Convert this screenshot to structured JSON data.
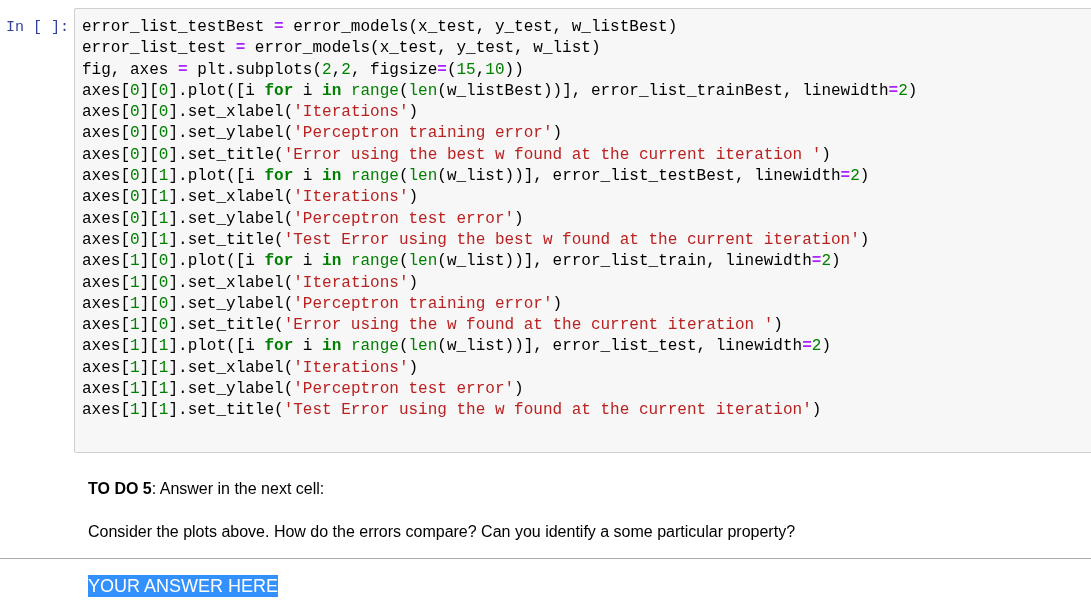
{
  "code_cell": {
    "prompt": "In [ ]:",
    "lines": [
      [
        {
          "kind": "plain",
          "text": "error_list_testBest "
        },
        {
          "kind": "op",
          "text": "="
        },
        {
          "kind": "plain",
          "text": " error_models(x_test, y_test, w_listBest)"
        }
      ],
      [
        {
          "kind": "plain",
          "text": "error_list_test "
        },
        {
          "kind": "op",
          "text": "="
        },
        {
          "kind": "plain",
          "text": " error_models(x_test, y_test, w_list)"
        }
      ],
      [
        {
          "kind": "plain",
          "text": "fig, axes "
        },
        {
          "kind": "op",
          "text": "="
        },
        {
          "kind": "plain",
          "text": " plt.subplots("
        },
        {
          "kind": "num",
          "text": "2"
        },
        {
          "kind": "plain",
          "text": ","
        },
        {
          "kind": "num",
          "text": "2"
        },
        {
          "kind": "plain",
          "text": ", figsize"
        },
        {
          "kind": "op",
          "text": "="
        },
        {
          "kind": "plain",
          "text": "("
        },
        {
          "kind": "num",
          "text": "15"
        },
        {
          "kind": "plain",
          "text": ","
        },
        {
          "kind": "num",
          "text": "10"
        },
        {
          "kind": "plain",
          "text": "))"
        }
      ],
      [
        {
          "kind": "plain",
          "text": "axes["
        },
        {
          "kind": "num",
          "text": "0"
        },
        {
          "kind": "plain",
          "text": "]["
        },
        {
          "kind": "num",
          "text": "0"
        },
        {
          "kind": "plain",
          "text": "].plot([i "
        },
        {
          "kind": "keyword",
          "text": "for"
        },
        {
          "kind": "plain",
          "text": " i "
        },
        {
          "kind": "keyword",
          "text": "in"
        },
        {
          "kind": "builtin",
          "text": " range"
        },
        {
          "kind": "plain",
          "text": "("
        },
        {
          "kind": "builtin",
          "text": "len"
        },
        {
          "kind": "plain",
          "text": "(w_listBest))], error_list_trainBest, linewidth"
        },
        {
          "kind": "op",
          "text": "="
        },
        {
          "kind": "num",
          "text": "2"
        },
        {
          "kind": "plain",
          "text": ")"
        }
      ],
      [
        {
          "kind": "plain",
          "text": "axes["
        },
        {
          "kind": "num",
          "text": "0"
        },
        {
          "kind": "plain",
          "text": "]["
        },
        {
          "kind": "num",
          "text": "0"
        },
        {
          "kind": "plain",
          "text": "].set_xlabel("
        },
        {
          "kind": "string",
          "text": "'Iterations'"
        },
        {
          "kind": "plain",
          "text": ")"
        }
      ],
      [
        {
          "kind": "plain",
          "text": "axes["
        },
        {
          "kind": "num",
          "text": "0"
        },
        {
          "kind": "plain",
          "text": "]["
        },
        {
          "kind": "num",
          "text": "0"
        },
        {
          "kind": "plain",
          "text": "].set_ylabel("
        },
        {
          "kind": "string",
          "text": "'Perceptron training error'"
        },
        {
          "kind": "plain",
          "text": ")"
        }
      ],
      [
        {
          "kind": "plain",
          "text": "axes["
        },
        {
          "kind": "num",
          "text": "0"
        },
        {
          "kind": "plain",
          "text": "]["
        },
        {
          "kind": "num",
          "text": "0"
        },
        {
          "kind": "plain",
          "text": "].set_title("
        },
        {
          "kind": "string",
          "text": "'Error using the best w found at the current iteration '"
        },
        {
          "kind": "plain",
          "text": ")"
        }
      ],
      [
        {
          "kind": "plain",
          "text": "axes["
        },
        {
          "kind": "num",
          "text": "0"
        },
        {
          "kind": "plain",
          "text": "]["
        },
        {
          "kind": "num",
          "text": "1"
        },
        {
          "kind": "plain",
          "text": "].plot([i "
        },
        {
          "kind": "keyword",
          "text": "for"
        },
        {
          "kind": "plain",
          "text": " i "
        },
        {
          "kind": "keyword",
          "text": "in"
        },
        {
          "kind": "builtin",
          "text": " range"
        },
        {
          "kind": "plain",
          "text": "("
        },
        {
          "kind": "builtin",
          "text": "len"
        },
        {
          "kind": "plain",
          "text": "(w_list))], error_list_testBest, linewidth"
        },
        {
          "kind": "op",
          "text": "="
        },
        {
          "kind": "num",
          "text": "2"
        },
        {
          "kind": "plain",
          "text": ")"
        }
      ],
      [
        {
          "kind": "plain",
          "text": "axes["
        },
        {
          "kind": "num",
          "text": "0"
        },
        {
          "kind": "plain",
          "text": "]["
        },
        {
          "kind": "num",
          "text": "1"
        },
        {
          "kind": "plain",
          "text": "].set_xlabel("
        },
        {
          "kind": "string",
          "text": "'Iterations'"
        },
        {
          "kind": "plain",
          "text": ")"
        }
      ],
      [
        {
          "kind": "plain",
          "text": "axes["
        },
        {
          "kind": "num",
          "text": "0"
        },
        {
          "kind": "plain",
          "text": "]["
        },
        {
          "kind": "num",
          "text": "1"
        },
        {
          "kind": "plain",
          "text": "].set_ylabel("
        },
        {
          "kind": "string",
          "text": "'Perceptron test error'"
        },
        {
          "kind": "plain",
          "text": ")"
        }
      ],
      [
        {
          "kind": "plain",
          "text": "axes["
        },
        {
          "kind": "num",
          "text": "0"
        },
        {
          "kind": "plain",
          "text": "]["
        },
        {
          "kind": "num",
          "text": "1"
        },
        {
          "kind": "plain",
          "text": "].set_title("
        },
        {
          "kind": "string",
          "text": "'Test Error using the best w found at the current iteration'"
        },
        {
          "kind": "plain",
          "text": ")"
        }
      ],
      [
        {
          "kind": "plain",
          "text": "axes["
        },
        {
          "kind": "num",
          "text": "1"
        },
        {
          "kind": "plain",
          "text": "]["
        },
        {
          "kind": "num",
          "text": "0"
        },
        {
          "kind": "plain",
          "text": "].plot([i "
        },
        {
          "kind": "keyword",
          "text": "for"
        },
        {
          "kind": "plain",
          "text": " i "
        },
        {
          "kind": "keyword",
          "text": "in"
        },
        {
          "kind": "builtin",
          "text": " range"
        },
        {
          "kind": "plain",
          "text": "("
        },
        {
          "kind": "builtin",
          "text": "len"
        },
        {
          "kind": "plain",
          "text": "(w_list))], error_list_train, linewidth"
        },
        {
          "kind": "op",
          "text": "="
        },
        {
          "kind": "num",
          "text": "2"
        },
        {
          "kind": "plain",
          "text": ")"
        }
      ],
      [
        {
          "kind": "plain",
          "text": "axes["
        },
        {
          "kind": "num",
          "text": "1"
        },
        {
          "kind": "plain",
          "text": "]["
        },
        {
          "kind": "num",
          "text": "0"
        },
        {
          "kind": "plain",
          "text": "].set_xlabel("
        },
        {
          "kind": "string",
          "text": "'Iterations'"
        },
        {
          "kind": "plain",
          "text": ")"
        }
      ],
      [
        {
          "kind": "plain",
          "text": "axes["
        },
        {
          "kind": "num",
          "text": "1"
        },
        {
          "kind": "plain",
          "text": "]["
        },
        {
          "kind": "num",
          "text": "0"
        },
        {
          "kind": "plain",
          "text": "].set_ylabel("
        },
        {
          "kind": "string",
          "text": "'Perceptron training error'"
        },
        {
          "kind": "plain",
          "text": ")"
        }
      ],
      [
        {
          "kind": "plain",
          "text": "axes["
        },
        {
          "kind": "num",
          "text": "1"
        },
        {
          "kind": "plain",
          "text": "]["
        },
        {
          "kind": "num",
          "text": "0"
        },
        {
          "kind": "plain",
          "text": "].set_title("
        },
        {
          "kind": "string",
          "text": "'Error using the w found at the current iteration '"
        },
        {
          "kind": "plain",
          "text": ")"
        }
      ],
      [
        {
          "kind": "plain",
          "text": "axes["
        },
        {
          "kind": "num",
          "text": "1"
        },
        {
          "kind": "plain",
          "text": "]["
        },
        {
          "kind": "num",
          "text": "1"
        },
        {
          "kind": "plain",
          "text": "].plot([i "
        },
        {
          "kind": "keyword",
          "text": "for"
        },
        {
          "kind": "plain",
          "text": " i "
        },
        {
          "kind": "keyword",
          "text": "in"
        },
        {
          "kind": "builtin",
          "text": " range"
        },
        {
          "kind": "plain",
          "text": "("
        },
        {
          "kind": "builtin",
          "text": "len"
        },
        {
          "kind": "plain",
          "text": "(w_list))], error_list_test, linewidth"
        },
        {
          "kind": "op",
          "text": "="
        },
        {
          "kind": "num",
          "text": "2"
        },
        {
          "kind": "plain",
          "text": ")"
        }
      ],
      [
        {
          "kind": "plain",
          "text": "axes["
        },
        {
          "kind": "num",
          "text": "1"
        },
        {
          "kind": "plain",
          "text": "]["
        },
        {
          "kind": "num",
          "text": "1"
        },
        {
          "kind": "plain",
          "text": "].set_xlabel("
        },
        {
          "kind": "string",
          "text": "'Iterations'"
        },
        {
          "kind": "plain",
          "text": ")"
        }
      ],
      [
        {
          "kind": "plain",
          "text": "axes["
        },
        {
          "kind": "num",
          "text": "1"
        },
        {
          "kind": "plain",
          "text": "]["
        },
        {
          "kind": "num",
          "text": "1"
        },
        {
          "kind": "plain",
          "text": "].set_ylabel("
        },
        {
          "kind": "string",
          "text": "'Perceptron test error'"
        },
        {
          "kind": "plain",
          "text": ")"
        }
      ],
      [
        {
          "kind": "plain",
          "text": "axes["
        },
        {
          "kind": "num",
          "text": "1"
        },
        {
          "kind": "plain",
          "text": "]["
        },
        {
          "kind": "num",
          "text": "1"
        },
        {
          "kind": "plain",
          "text": "].set_title("
        },
        {
          "kind": "string",
          "text": "'Test Error using the w found at the current iteration'"
        },
        {
          "kind": "plain",
          "text": ")"
        }
      ]
    ]
  },
  "markdown_cell": {
    "paragraphs": [
      "**TO DO 5**: Answer in the next cell:",
      "Consider the plots above. How do the errors compare? Can you identify a some particular property?"
    ]
  },
  "answer_cell": {
    "text": "YOUR ANSWER HERE",
    "selected": true
  }
}
